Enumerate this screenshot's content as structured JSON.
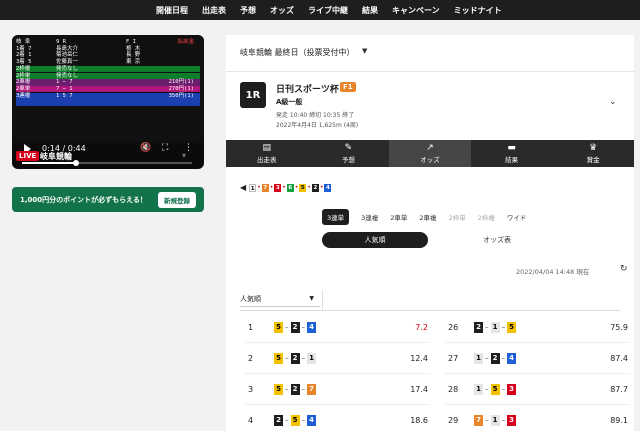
{
  "nav": {
    "items": [
      "開催日程",
      "出走表",
      "予想",
      "オッズ",
      "ライブ中継",
      "結果",
      "キャンペーン",
      "ミッドナイト"
    ]
  },
  "player": {
    "overlay_rows": [
      {
        "c1": "岐 阜",
        "c2": "9 R",
        "c3": "F I",
        "c4": "払戻金",
        "bg": "#101010",
        "c4color": "#ff4040"
      },
      {
        "c1": "1着 7",
        "c2": "長島大介",
        "c3": "栃 木",
        "c4": "",
        "bg": "#101010",
        "c4color": "#fff"
      },
      {
        "c1": "2着 1",
        "c2": "菊池岳仁",
        "c3": "長 野",
        "c4": "",
        "bg": "#101010",
        "c4color": "#fff"
      },
      {
        "c1": "3着 5",
        "c2": "佐藤真一",
        "c3": "東 京",
        "c4": "",
        "bg": "#101010",
        "c4color": "#fff"
      },
      {
        "c1": "2枠複",
        "c2": "発売なし",
        "c3": "",
        "c4": "",
        "bg": "#0e7d2c",
        "c4color": "#fff"
      },
      {
        "c1": "2枠単",
        "c2": "発売なし",
        "c3": "",
        "c4": "",
        "bg": "#0e7d2c",
        "c4color": "#fff"
      },
      {
        "c1": "2車複",
        "c2": "1 − 7",
        "c3": "",
        "c4": "210円(1)",
        "bg": "#6b1d6e",
        "c4color": "#fff"
      },
      {
        "c1": "2車単",
        "c2": "7 − 1",
        "c3": "",
        "c4": "270円(1)",
        "bg": "#b0177b",
        "c4color": "#fff"
      },
      {
        "c1": "3連複",
        "c2": "1 5 7",
        "c3": "",
        "c4": "350円(1)",
        "bg": "#1c3fb0",
        "c4color": "#fff"
      },
      {
        "c1": "",
        "c2": "",
        "c3": "",
        "c4": "",
        "bg": "#1c3fb0",
        "c4color": "#fff"
      }
    ],
    "time": "0:14 / 0:44",
    "progress": 0.32,
    "live_label": "LIVE",
    "venue": "岐阜競輪"
  },
  "promo": {
    "text": "1,000円分のポイントが必ずもらえる！",
    "button": "新規登録"
  },
  "meet": {
    "label": "岐阜競輪 最終日（投票受付中）"
  },
  "race": {
    "number": "1R",
    "title": "日刊スポーツ杯",
    "grade": "F1",
    "class": "A級一般",
    "time": "発走 10:40 締切 10:35 終了",
    "date": "2022年4月4日 1,625m (4周)"
  },
  "tabs": [
    {
      "label": "出走表",
      "icon": "race-card-icon",
      "glyph": "▤"
    },
    {
      "label": "予想",
      "icon": "prediction-icon",
      "glyph": "✎"
    },
    {
      "label": "オッズ",
      "icon": "odds-chart-icon",
      "glyph": "↗"
    },
    {
      "label": "結果",
      "icon": "result-icon",
      "glyph": "▬"
    },
    {
      "label": "賞金",
      "icon": "trophy-icon",
      "glyph": "♛"
    }
  ],
  "last_result": {
    "numbers": [
      1,
      7,
      3,
      6,
      5,
      2,
      4
    ]
  },
  "bet_types": [
    {
      "label": "3連単",
      "state": "active"
    },
    {
      "label": "3連複",
      "state": "normal"
    },
    {
      "label": "2車単",
      "state": "normal"
    },
    {
      "label": "2車複",
      "state": "normal"
    },
    {
      "label": "2枠単",
      "state": "disabled"
    },
    {
      "label": "2枠複",
      "state": "disabled"
    },
    {
      "label": "ワイド",
      "state": "normal"
    }
  ],
  "view_toggle": {
    "popular": "人気順",
    "table": "オッズ表"
  },
  "as_of": "2022/04/04 14:48 現在",
  "sort": {
    "selected": "人気順"
  },
  "odds_left": [
    {
      "rank": "1",
      "combo": [
        5,
        2,
        4
      ],
      "odds": "7.2",
      "hot": true
    },
    {
      "rank": "2",
      "combo": [
        5,
        2,
        1
      ],
      "odds": "12.4",
      "hot": false
    },
    {
      "rank": "3",
      "combo": [
        5,
        2,
        7
      ],
      "odds": "17.4",
      "hot": false
    },
    {
      "rank": "4",
      "combo": [
        2,
        5,
        4
      ],
      "odds": "18.6",
      "hot": false
    }
  ],
  "odds_right": [
    {
      "rank": "26",
      "combo": [
        2,
        1,
        5
      ],
      "odds": "75.9",
      "hot": false
    },
    {
      "rank": "27",
      "combo": [
        1,
        2,
        4
      ],
      "odds": "87.4",
      "hot": false
    },
    {
      "rank": "28",
      "combo": [
        1,
        5,
        3
      ],
      "odds": "87.7",
      "hot": false
    },
    {
      "rank": "29",
      "combo": [
        7,
        1,
        3
      ],
      "odds": "89.1",
      "hot": false
    }
  ]
}
